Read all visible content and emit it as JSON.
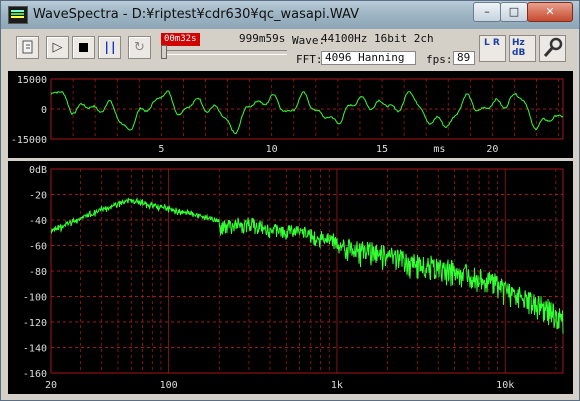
{
  "window": {
    "title": "WaveSpectra - D:¥riptest¥cdr630¥qc_wasapi.WAV",
    "min_glyph": "–",
    "max_glyph": "□",
    "close_glyph": "✕"
  },
  "toolbar": {
    "open_icon": "open-file-icon",
    "play_glyph": "▷",
    "stop_icon": "stop-icon",
    "pause_glyph": "| |",
    "record_glyph": "↻",
    "time_display": "00m32s",
    "track_length": "999m59s",
    "wave_label": "Wave:",
    "wave_info": "44100Hz 16bit 2ch",
    "fft_label": "FFT:",
    "fft_info": "4096 Hanning",
    "fps_label": "fps:",
    "fps_value": "89",
    "lr_button": "L R",
    "hz_db_button": "Hz dB",
    "settings_icon": "wrench-icon"
  },
  "wave_plot": {
    "y_ticks": [
      "15000",
      "0",
      "-15000"
    ],
    "y_values": [
      15000,
      0,
      -15000
    ],
    "x_ticks": [
      "5",
      "10",
      "15",
      "20"
    ],
    "x_values": [
      5,
      10,
      15,
      20
    ],
    "x_unit": "ms",
    "x_max": 23.2,
    "line_color": "#33ff33",
    "grid_color": "#a01818"
  },
  "spectrum_plot": {
    "y_ticks": [
      "0dB",
      "-20",
      "-40",
      "-60",
      "-80",
      "-100",
      "-120",
      "-140",
      "-160"
    ],
    "y_values": [
      0,
      -20,
      -40,
      -60,
      -80,
      -100,
      -120,
      -140,
      -160
    ],
    "x_ticks": [
      "20",
      "100",
      "1k",
      "10k"
    ],
    "x_values": [
      20,
      100,
      1000,
      10000
    ],
    "x_range": [
      20,
      22050
    ],
    "line_color": "#33ff33",
    "grid_color": "#a01818"
  }
}
